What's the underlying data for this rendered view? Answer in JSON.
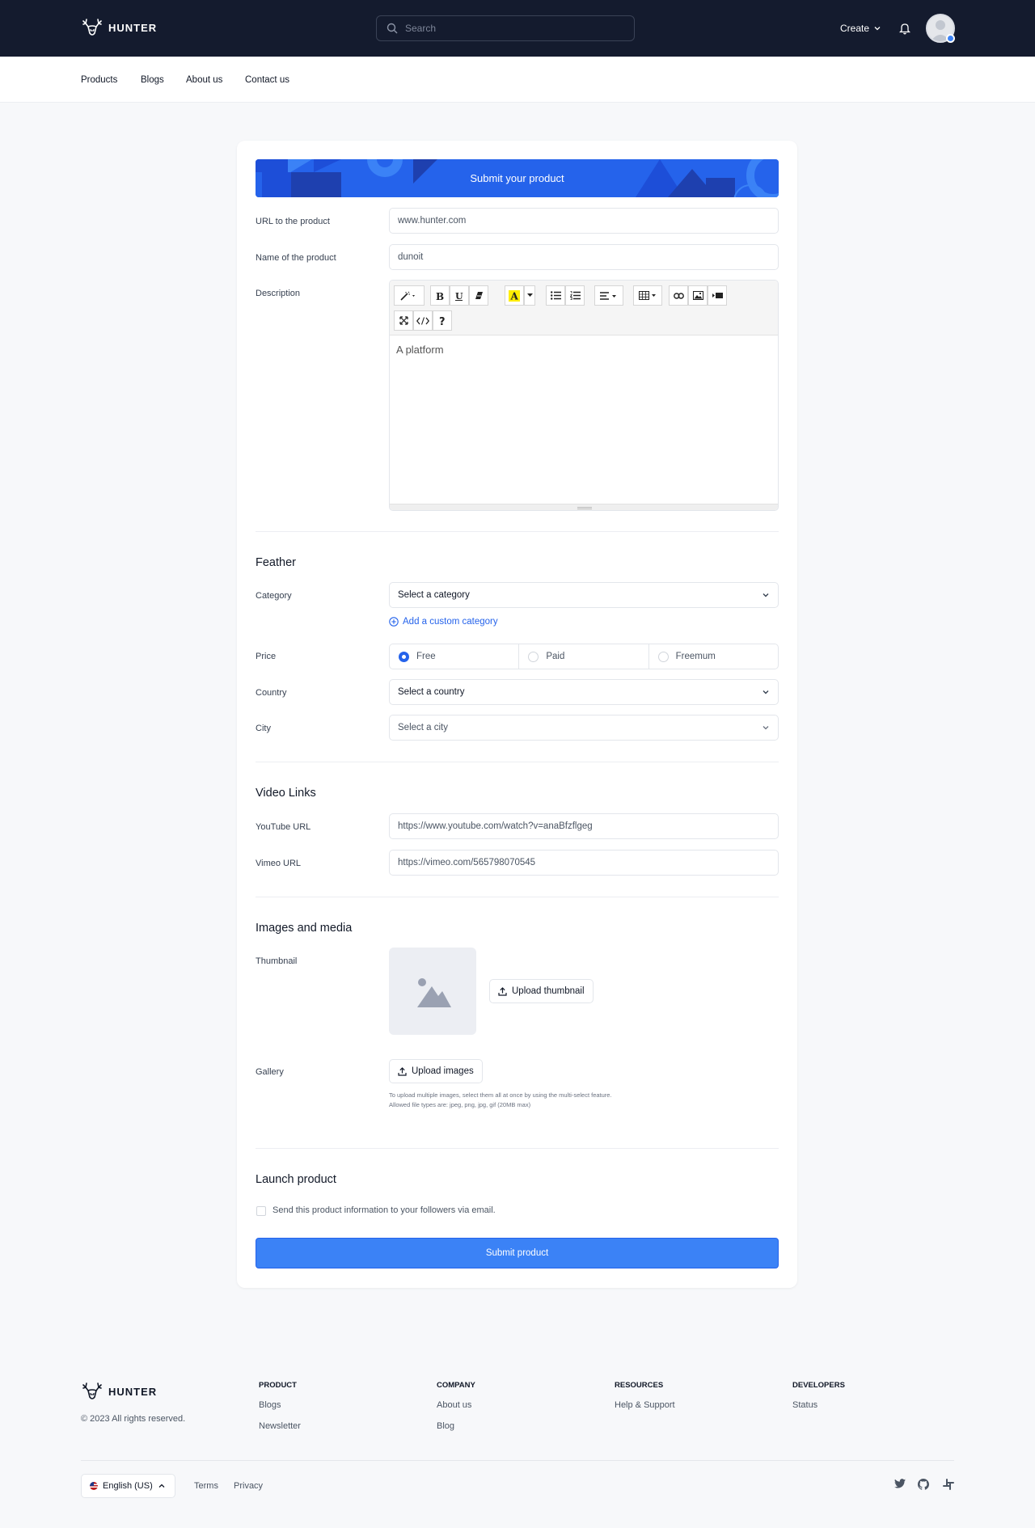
{
  "header": {
    "brand": "HUNTER",
    "search_placeholder": "Search",
    "create_label": "Create"
  },
  "subnav": {
    "items": [
      "Products",
      "Blogs",
      "About us",
      "Contact us"
    ]
  },
  "form": {
    "banner_title": "Submit your product",
    "url_label": "URL to the product",
    "url_value": "www.hunter.com",
    "name_label": "Name of the product",
    "name_value": "dunoit",
    "description_label": "Description",
    "description_value": "A platform",
    "feather": {
      "heading": "Feather",
      "category_label": "Category",
      "category_value": "Select a category",
      "add_custom_category": "Add a custom category",
      "price_label": "Price",
      "price_options": [
        "Free",
        "Paid",
        "Freemum"
      ],
      "price_selected": "Free",
      "country_label": "Country",
      "country_value": "Select a country",
      "city_label": "City",
      "city_value": "Select a city"
    },
    "video": {
      "heading": "Video Links",
      "youtube_label": "YouTube URL",
      "youtube_value": "https://www.youtube.com/watch?v=anaBfzflgeg",
      "vimeo_label": "Vimeo URL",
      "vimeo_value": "https://vimeo.com/565798070545"
    },
    "media": {
      "heading": "Images and media",
      "thumbnail_label": "Thumbnail",
      "upload_thumbnail": "Upload thumbnail",
      "gallery_label": "Gallery",
      "upload_images": "Upload images",
      "hint_line1": "To upload multiple images, select them all at once by using the multi-select feature.",
      "hint_line2": "Allowed file types are: jpeg, png, jpg, gif (20MB max)"
    },
    "launch": {
      "heading": "Launch product",
      "email_checkbox_label": "Send this product information to your followers via email.",
      "submit_label": "Submit product"
    }
  },
  "footer": {
    "brand": "HUNTER",
    "copyright": "© 2023 All rights reserved.",
    "columns": [
      {
        "heading": "PRODUCT",
        "links": [
          "Blogs",
          "Newsletter"
        ]
      },
      {
        "heading": "COMPANY",
        "links": [
          "About us",
          "Blog"
        ]
      },
      {
        "heading": "RESOURCES",
        "links": [
          "Help & Support"
        ]
      },
      {
        "heading": "DEVELOPERS",
        "links": [
          "Status"
        ]
      }
    ],
    "language": "English (US)",
    "terms": "Terms",
    "privacy": "Privacy"
  },
  "colors": {
    "header_bg": "#141b2e",
    "accent": "#2563eb",
    "submit_bg": "#3b82f6",
    "page_bg": "#f7f8fa"
  }
}
